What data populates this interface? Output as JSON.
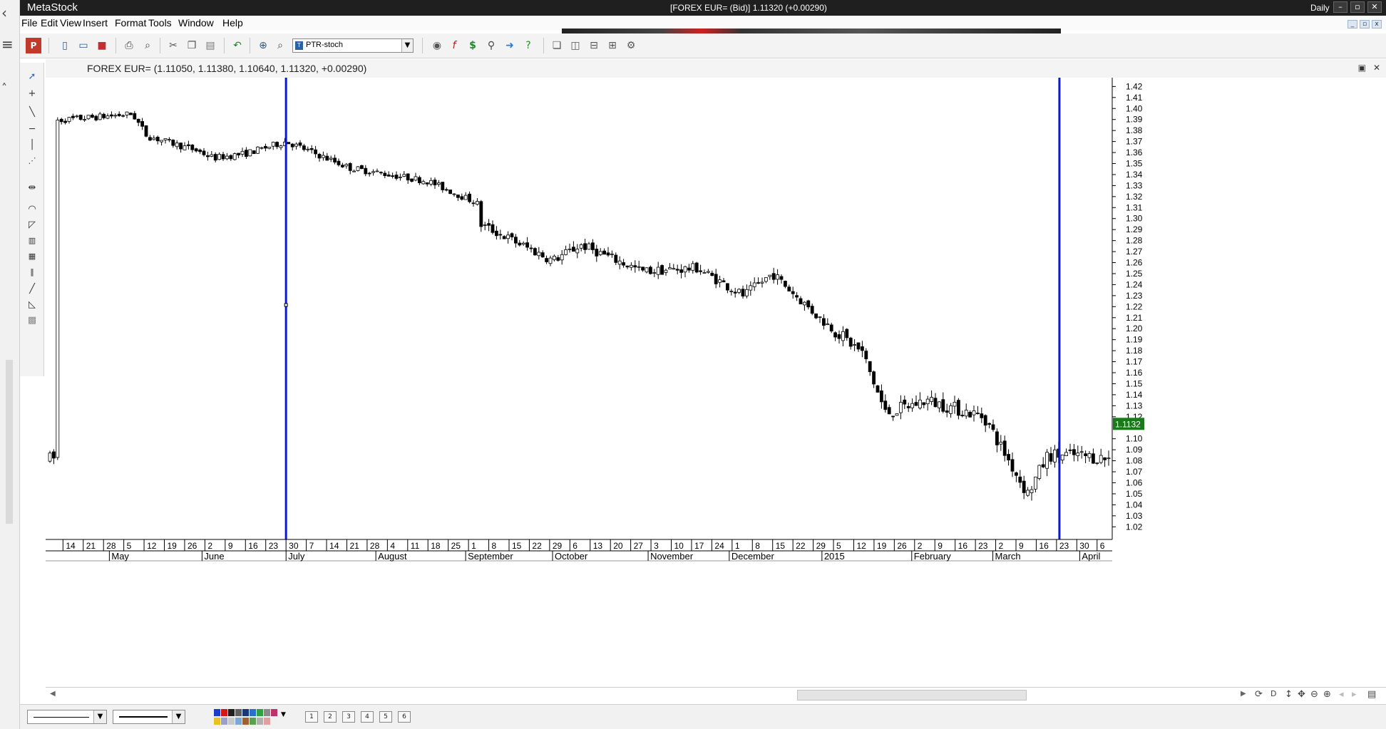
{
  "app": {
    "name": "MetaStock",
    "document_title": "[FOREX EUR= (Bid)]   1.11320 (+0.00290)",
    "period": "Daily",
    "window_buttons": [
      "–",
      "▫",
      "✕"
    ]
  },
  "menu": {
    "items": [
      "File",
      "Edit",
      "View",
      "Insert",
      "Format",
      "Tools",
      "Window",
      "Help"
    ]
  },
  "toolbar": {
    "template_name": "PTR-stoch"
  },
  "chart_header": {
    "security_line": "FOREX EUR= (1.11050, 1.11380, 1.10640, 1.11320, +0.00290)"
  },
  "chart_data": {
    "type": "candlestick",
    "title": "FOREX EUR= (1.11050, 1.11380, 1.10640, 1.11320, +0.00290)",
    "last_price_label": "1.1132",
    "y_ticks": [
      "1.42",
      "1.41",
      "1.40",
      "1.39",
      "1.38",
      "1.37",
      "1.36",
      "1.35",
      "1.34",
      "1.33",
      "1.32",
      "1.31",
      "1.30",
      "1.29",
      "1.28",
      "1.27",
      "1.26",
      "1.25",
      "1.24",
      "1.23",
      "1.22",
      "1.21",
      "1.20",
      "1.19",
      "1.18",
      "1.17",
      "1.16",
      "1.15",
      "1.14",
      "1.13",
      "1.12",
      "1.10",
      "1.09",
      "1.08",
      "1.07",
      "1.06",
      "1.05",
      "1.04",
      "1.03",
      "1.02"
    ],
    "ylim": [
      1.015,
      1.428
    ],
    "day_ticks": [
      "14",
      "21",
      "28",
      "5",
      "12",
      "19",
      "26",
      "2",
      "9",
      "16",
      "23",
      "30",
      "7",
      "14",
      "21",
      "28",
      "4",
      "11",
      "18",
      "25",
      "1",
      "8",
      "15",
      "22",
      "29",
      "6",
      "13",
      "20",
      "27",
      "3",
      "10",
      "17",
      "24",
      "1",
      "8",
      "15",
      "22",
      "29",
      "5",
      "12",
      "19",
      "26",
      "2",
      "9",
      "16",
      "23",
      "2",
      "9",
      "16",
      "23",
      "30",
      "6"
    ],
    "month_labels": [
      "May",
      "June",
      "July",
      "August",
      "September",
      "October",
      "November",
      "December",
      "2015",
      "February",
      "March",
      "April"
    ],
    "vertical_markers": [
      "30 June 2014",
      "24 March 2015"
    ],
    "approximate_close_path": [
      {
        "date": "2014-04-11",
        "value": 1.389
      },
      {
        "date": "2014-05-08",
        "value": 1.395
      },
      {
        "date": "2014-05-13",
        "value": 1.375
      },
      {
        "date": "2014-05-30",
        "value": 1.362
      },
      {
        "date": "2014-06-05",
        "value": 1.355
      },
      {
        "date": "2014-06-16",
        "value": 1.359
      },
      {
        "date": "2014-06-30",
        "value": 1.37
      },
      {
        "date": "2014-07-22",
        "value": 1.346
      },
      {
        "date": "2014-08-18",
        "value": 1.334
      },
      {
        "date": "2014-09-04",
        "value": 1.314
      },
      {
        "date": "2014-09-05",
        "value": 1.295
      },
      {
        "date": "2014-09-30",
        "value": 1.262
      },
      {
        "date": "2014-10-10",
        "value": 1.276
      },
      {
        "date": "2014-10-31",
        "value": 1.252
      },
      {
        "date": "2014-11-19",
        "value": 1.255
      },
      {
        "date": "2014-12-05",
        "value": 1.23
      },
      {
        "date": "2014-12-15",
        "value": 1.25
      },
      {
        "date": "2014-12-31",
        "value": 1.21
      },
      {
        "date": "2015-01-15",
        "value": 1.178
      },
      {
        "date": "2015-01-23",
        "value": 1.123
      },
      {
        "date": "2015-02-06",
        "value": 1.135
      },
      {
        "date": "2015-02-26",
        "value": 1.12
      },
      {
        "date": "2015-03-13",
        "value": 1.05
      },
      {
        "date": "2015-03-20",
        "value": 1.085
      },
      {
        "date": "2015-03-30",
        "value": 1.085
      },
      {
        "date": "2015-04-09",
        "value": 1.082
      }
    ]
  },
  "statusbar": {
    "palette_colors": [
      "#1a3cc8",
      "#d01818",
      "#202020",
      "#606060",
      "#183878",
      "#2a70c8",
      "#30a040",
      "#8a8a8a",
      "#c0306a",
      "#e8c020",
      "#9aa0c8",
      "#c8c8c8",
      "#7aa8d8",
      "#a06030",
      "#5aa050",
      "#b0b0b0",
      "#e0a0a0",
      "#f0f0f0"
    ]
  }
}
